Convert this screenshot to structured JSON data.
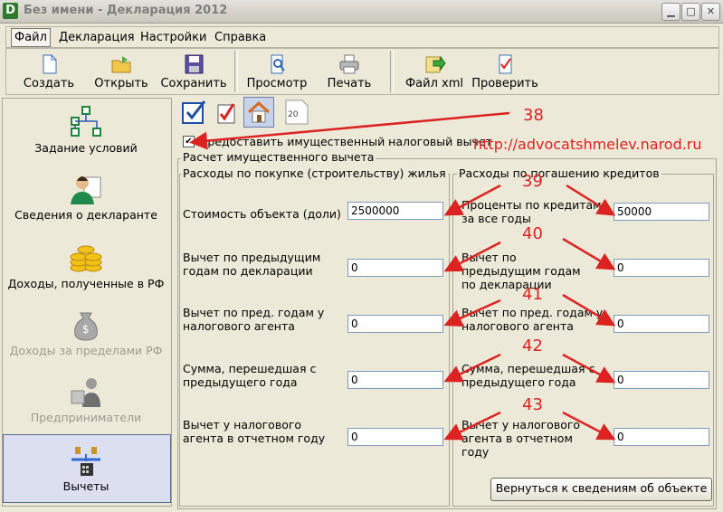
{
  "window": {
    "title": "Без имени - Декларация 2012",
    "app_icon": "D"
  },
  "menu": [
    "Файл",
    "Декларация",
    "Настройки",
    "Справка"
  ],
  "toolbar": [
    {
      "label": "Создать",
      "icon": "new-document-icon"
    },
    {
      "label": "Открыть",
      "icon": "open-folder-icon"
    },
    {
      "label": "Сохранить",
      "icon": "save-floppy-icon"
    },
    {
      "label": "Просмотр",
      "icon": "preview-icon"
    },
    {
      "label": "Печать",
      "icon": "printer-icon"
    },
    {
      "label": "Файл xml",
      "icon": "export-xml-icon"
    },
    {
      "label": "Проверить",
      "icon": "check-document-icon"
    }
  ],
  "nav": [
    {
      "label": "Задание условий",
      "icon": "conditions-diagram-icon",
      "disabled": false,
      "active": false
    },
    {
      "label": "Сведения о декларанте",
      "icon": "person-icon",
      "disabled": false,
      "active": false
    },
    {
      "label": "Доходы, полученные в РФ",
      "icon": "coins-icon",
      "disabled": false,
      "active": false
    },
    {
      "label": "Доходы за пределами РФ",
      "icon": "money-bag-icon",
      "disabled": true,
      "active": false
    },
    {
      "label": "Предприниматели",
      "icon": "entrepreneur-icon",
      "disabled": true,
      "active": false
    },
    {
      "label": "Вычеты",
      "icon": "deductions-scales-icon",
      "disabled": false,
      "active": true
    }
  ],
  "subtabs": [
    "standard-deductions-icon",
    "social-deductions-icon",
    "property-deduction-icon",
    "tab-20-icon"
  ],
  "subtab_20_text": "20",
  "main": {
    "checkbox_label": "Предоставить имущественный налоговый вычет",
    "checkbox_checked": true,
    "group_title": "Расчет имущественного вычета",
    "left_title": "Расходы по покупке (строительству) жилья",
    "right_title": "Расходы по погашению кредитов",
    "left_fields": [
      {
        "label": "Стоимость объекта (доли)",
        "value": "2500000"
      },
      {
        "label": "Вычет по предыдущим годам по декларации",
        "value": "0"
      },
      {
        "label": "Вычет по пред. годам у налогового агента",
        "value": "0"
      },
      {
        "label": "Сумма, перешедшая с предыдущего года",
        "value": "0"
      },
      {
        "label": "Вычет у налогового агента в отчетном году",
        "value": "0"
      }
    ],
    "right_fields": [
      {
        "label": "Проценты по кредитам за все годы",
        "value": "50000"
      },
      {
        "label": "Вычет по предыдущим годам по декларации",
        "value": "0"
      },
      {
        "label": "Вычет по пред. годам у налогового агента",
        "value": "0"
      },
      {
        "label": "Сумма, перешедшая с предыдущего года",
        "value": "0"
      },
      {
        "label": "Вычет у налогового агента в отчетном году",
        "value": "0"
      }
    ],
    "return_button": "Вернуться к сведениям об объекте"
  },
  "annotations": {
    "url": "http://advocatshmelev.narod.ru",
    "numbers": [
      "38",
      "39",
      "40",
      "41",
      "42",
      "43"
    ],
    "color": "#d22222"
  }
}
